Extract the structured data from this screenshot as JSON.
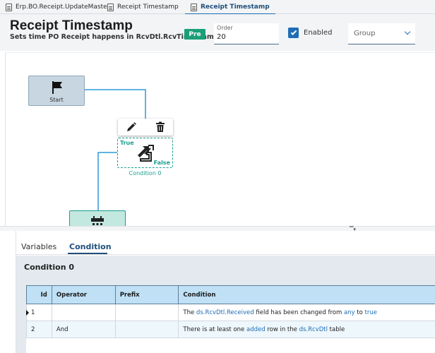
{
  "tabs": [
    {
      "label": "Erp.BO.Receipt.UpdateMaster"
    },
    {
      "label": "Receipt Timestamp"
    },
    {
      "label": "Receipt Timestamp",
      "active": true
    }
  ],
  "header": {
    "title": "Receipt Timestamp",
    "subtitle": "Sets time PO Receipt happens in RcvDtl.RcvTimestamp_c",
    "badge": "Pre",
    "order_label": "Order",
    "order_value": "20",
    "enabled_label": "Enabled",
    "enabled_checked": true,
    "group_placeholder": "Group"
  },
  "canvas": {
    "start_label": "Start",
    "true_label": "True",
    "false_label": "False",
    "condition_caption": "Condition 0"
  },
  "panel": {
    "tabs": [
      "Variables",
      "Condition"
    ],
    "active_tab": "Condition",
    "section_title": "Condition 0",
    "columns": [
      "Id",
      "Operator",
      "Prefix",
      "Condition"
    ],
    "rows": [
      {
        "id": "1",
        "operator": "",
        "prefix": "",
        "condition": {
          "t1": "The ",
          "k1": "ds.RcvDtl.Received",
          "t2": " field has been changed from ",
          "k2": "any",
          "t3": " to ",
          "k3": "true"
        }
      },
      {
        "id": "2",
        "operator": "And",
        "prefix": "",
        "condition": {
          "t1": "There is at least one ",
          "k1": "added",
          "t2": " row in the ",
          "k2": "ds.RcvDtl",
          "t3": " table"
        }
      }
    ]
  },
  "colors": {
    "accent": "#1f6db5",
    "badge": "#1a9e77",
    "condition_teal": "#1a9e8f",
    "start_node": "#c7d6e0",
    "header_row": "#bfe0f5"
  },
  "icons": {
    "start": "flag-icon",
    "edit": "pencil-icon",
    "delete": "trash-icon",
    "condition": "condition-arrows-icon",
    "event": "calendar-icon"
  }
}
